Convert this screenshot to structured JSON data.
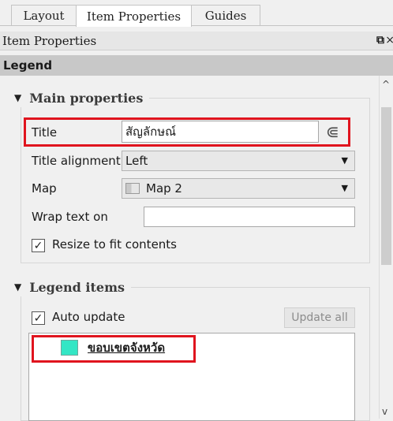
{
  "tabs": [
    {
      "label": "Layout",
      "active": false
    },
    {
      "label": "Item Properties",
      "active": true
    },
    {
      "label": "Guides",
      "active": false
    }
  ],
  "panel": {
    "title": "Item Properties"
  },
  "section": {
    "title": "Legend"
  },
  "main_properties": {
    "header": "Main properties",
    "title_label": "Title",
    "title_value": "สัญลักษณ์",
    "alignment_label": "Title alignment",
    "alignment_value": "Left",
    "map_label": "Map",
    "map_value": "Map 2",
    "wrap_label": "Wrap text on",
    "wrap_value": "",
    "resize_label": "Resize to fit contents",
    "resize_checked": true
  },
  "legend_items": {
    "header": "Legend items",
    "auto_update_label": "Auto update",
    "auto_update_checked": true,
    "update_all_label": "Update all",
    "items": [
      {
        "label": "ขอบเขตจังหวัด",
        "color": "#33e6c5"
      }
    ]
  },
  "colors": {
    "highlight": "#e0141e",
    "accent_swatch": "#33e6c5"
  }
}
